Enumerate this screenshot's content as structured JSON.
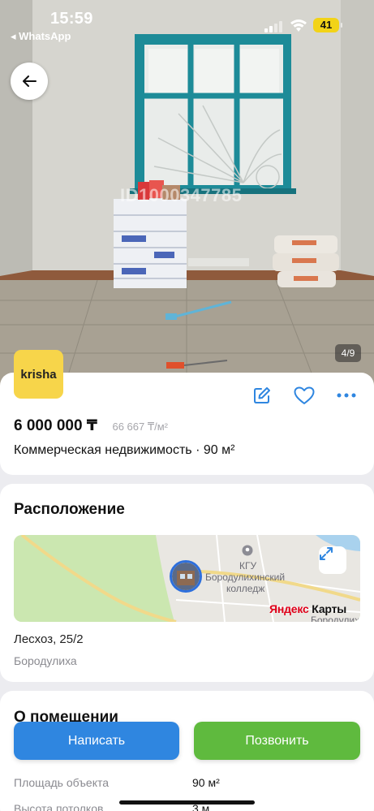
{
  "status_bar": {
    "time": "15:59",
    "back_app": "◂ WhatsApp",
    "battery": "41"
  },
  "photo": {
    "watermark": "ID1000347785",
    "counter": "4/9"
  },
  "icons": {
    "back": "arrow-left-icon",
    "edit": "edit-icon",
    "favorite": "heart-icon",
    "more": "more-dots-icon",
    "expand": "expand-icon",
    "poi": "pin-icon"
  },
  "colors": {
    "accent": "#2f86e0",
    "call": "#5fba3e",
    "logo_bg": "#f7d54a"
  },
  "listing": {
    "logo": "krisha",
    "price": "6 000 000 ₸",
    "price_per_m2": "66 667 ₸/м²",
    "subtitle": "Коммерческая недвижимость · 90 м²"
  },
  "location": {
    "title": "Расположение",
    "map_poi_label_1": "КГУ",
    "map_poi_label_2": "Бородулихинский",
    "map_poi_label_3": "колледж",
    "map_brand_1": "Яндекс",
    "map_brand_2": " Карты",
    "map_corner_label": "Бородулиха",
    "address": "Лесхоз, 25/2",
    "city": "Бородулиха"
  },
  "about": {
    "title": "О помещении",
    "rows": [
      {
        "label": "Площадь объекта",
        "value": "90 м²"
      },
      {
        "label": "Высота потолков",
        "value": "3 м"
      }
    ]
  },
  "buttons": {
    "write": "Написать",
    "call": "Позвонить"
  }
}
